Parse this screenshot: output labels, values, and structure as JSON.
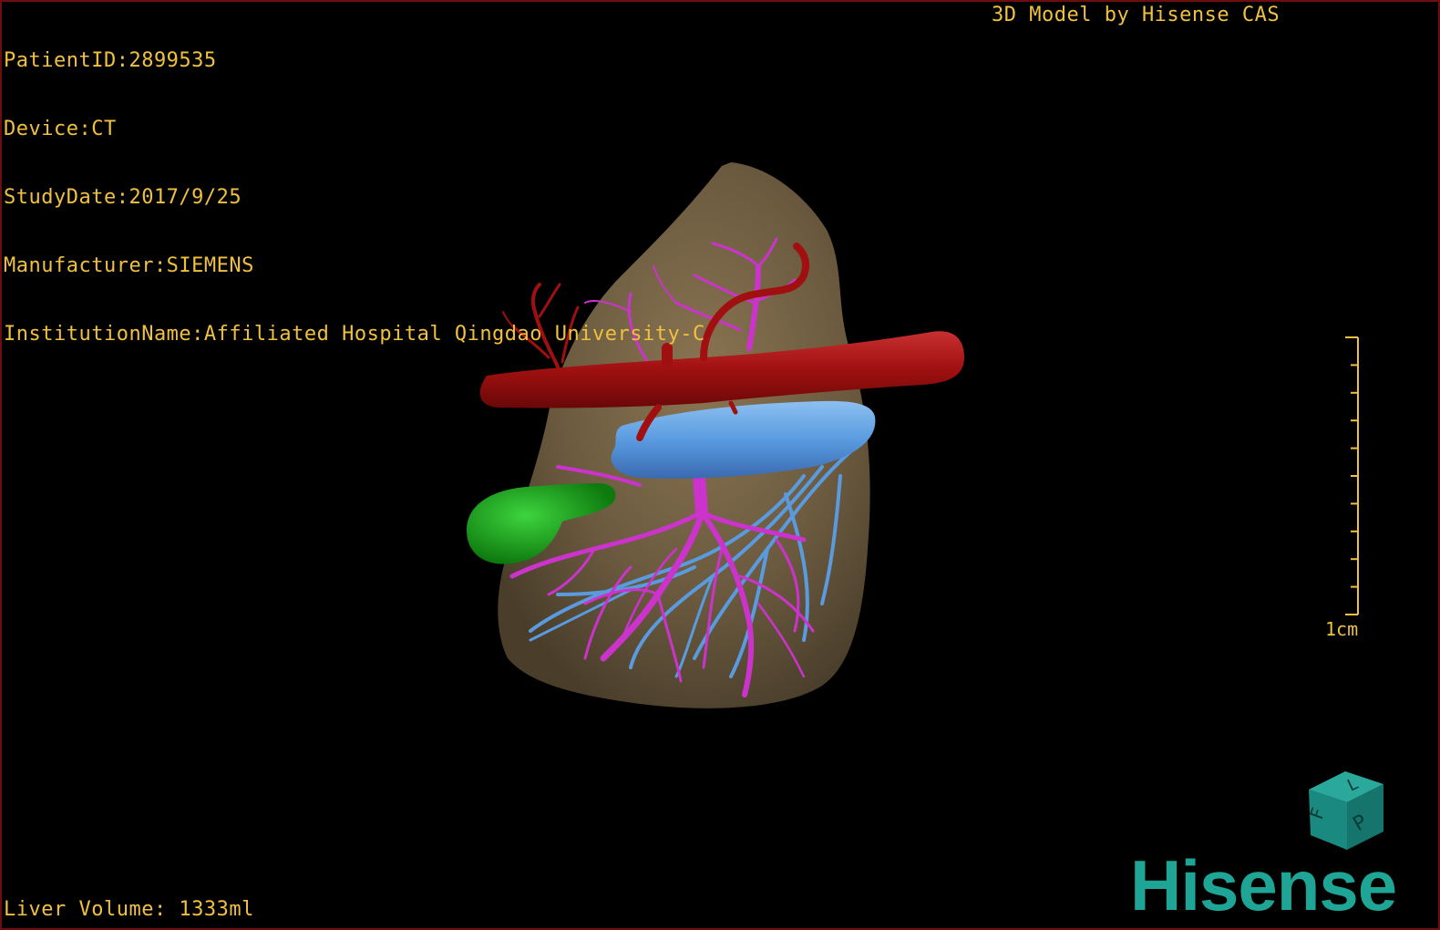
{
  "patient_info": {
    "patient_id": "PatientID:2899535",
    "device": "Device:CT",
    "study_date": "StudyDate:2017/9/25",
    "manufacturer": "Manufacturer:SIEMENS",
    "institution": "InstitutionName:Affiliated Hospital Qingdao University-C"
  },
  "caption": "3D Model by Hisense CAS",
  "liver_volume": "Liver Volume: 1333ml",
  "scale": {
    "label": "1cm",
    "tick_count": 10
  },
  "orientation_cube": {
    "faces": [
      "F",
      "L",
      "P"
    ],
    "color": "#1a8a80"
  },
  "logo": "Hisense",
  "colors": {
    "text": "#f0c040",
    "liver": "#6b5a3f",
    "artery": "#a01010",
    "portal_vein": "#cc33cc",
    "hepatic_vein": "#5a9be0",
    "gallbladder": "#1ea31e",
    "brand": "#1ea596"
  }
}
